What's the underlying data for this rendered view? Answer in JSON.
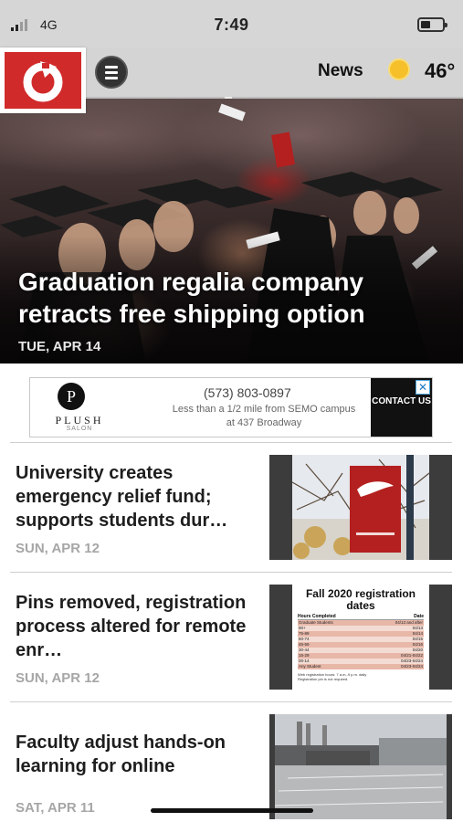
{
  "status_bar": {
    "carrier": "4G",
    "time": "7:49"
  },
  "header": {
    "section": "News",
    "temperature": "46°",
    "menu_icon": "hamburger-icon",
    "weather_icon": "sun-icon",
    "logo_icon": "refresh-arrow-icon",
    "accent_color": "#d12a2a"
  },
  "hero": {
    "title": "Graduation regalia company retracts free shipping option",
    "date": "TUE, APR 14"
  },
  "ad": {
    "brand_mark": "P",
    "brand": "PLUSH",
    "brand_sub": "SALON",
    "phone": "(573) 803-0897",
    "line1": "Less than a 1/2 mile from SEMO campus",
    "line2": "at 437 Broadway",
    "cta": "CONTACT US",
    "close_icon": "close-icon"
  },
  "stories": [
    {
      "title": "University creates emergency relief fund; supports students dur…",
      "date": "SUN, APR 12"
    },
    {
      "title": "Pins removed, registration process altered for remote enr…",
      "date": "SUN, APR 12",
      "thumb": {
        "heading": "Fall 2020 registration dates",
        "col_left": "Hours Completed",
        "col_right": "Date",
        "rows": [
          [
            "Graduate Students",
            "04/13 and after"
          ],
          [
            "90+",
            "04/13"
          ],
          [
            "75-89",
            "04/14"
          ],
          [
            "60-74",
            "04/15"
          ],
          [
            "45-59",
            "04/16"
          ],
          [
            "30-44",
            "04/20"
          ],
          [
            "15-29",
            "04/21-04/22"
          ],
          [
            "00-14",
            "04/23-04/24"
          ],
          [
            "Any Student",
            "04/23-04/24"
          ]
        ],
        "note1": "Web registration hours: 7 a.m.-9 p.m. daily",
        "note2": "Registration pin is not required."
      }
    },
    {
      "title": "Faculty adjust hands-on learning for online",
      "date": "SAT, APR 11"
    }
  ]
}
